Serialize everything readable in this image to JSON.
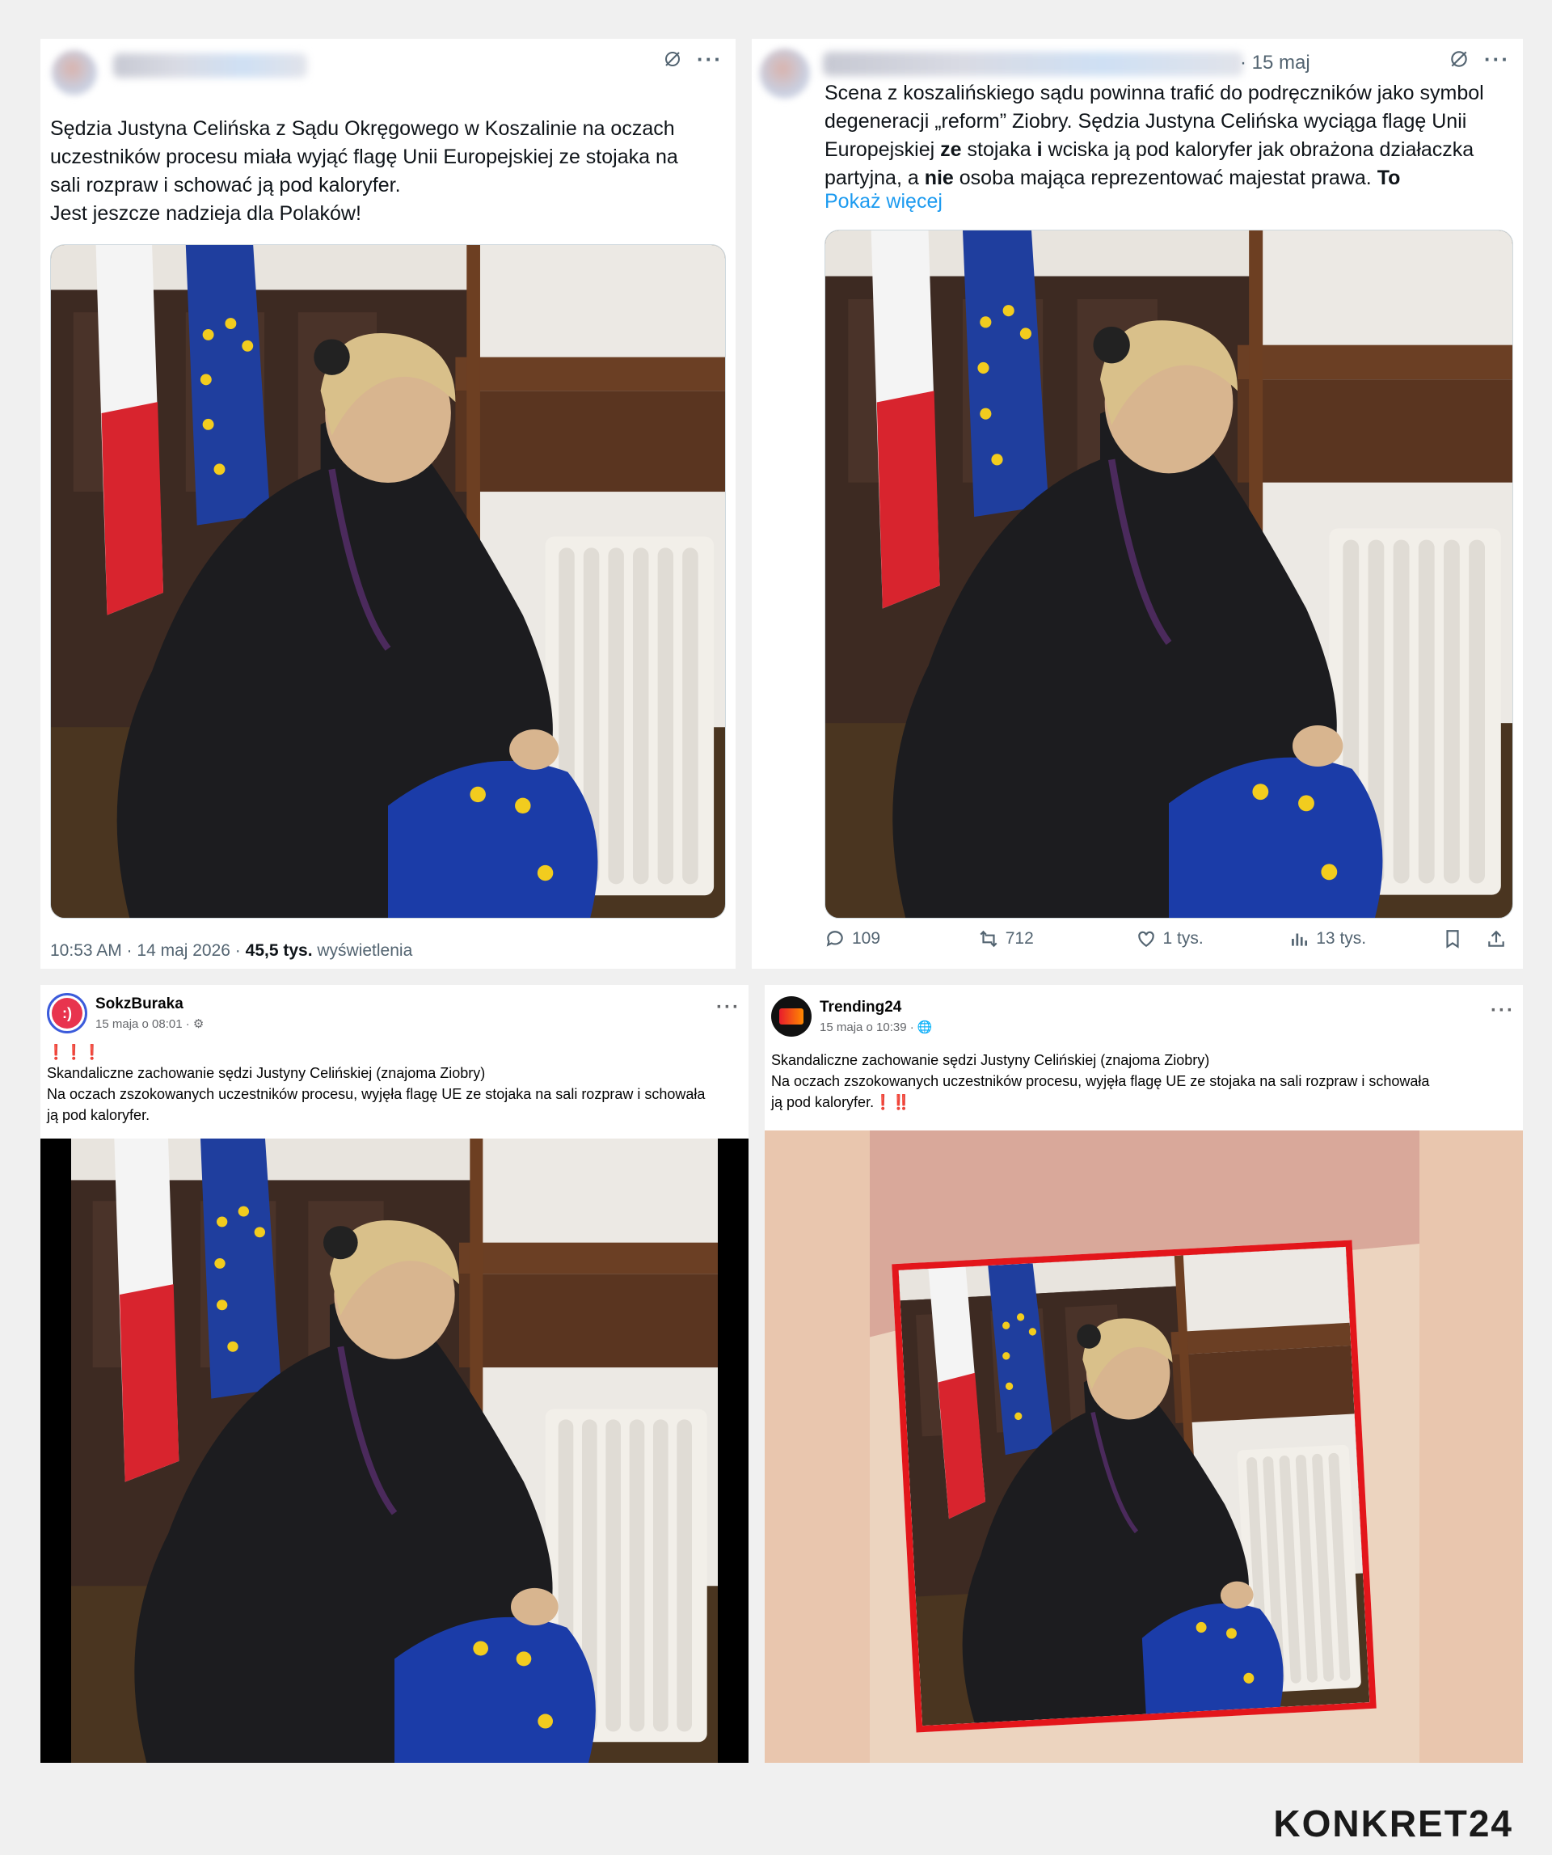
{
  "posts": {
    "p1": {
      "text": "Sędzia Justyna Celińska z Sądu Okręgowego w Koszalinie na oczach\nuczestników procesu miała  wyjąć flagę Unii Europejskiej ze stojaka na\nsali rozpraw i schować ją pod kaloryfer.\nJest jeszcze nadzieja dla Polaków!",
      "time": "10:53 AM · 14 maj 2026 · ",
      "views": "45,5 tys.",
      "views_label": " wyświetlenia"
    },
    "p2": {
      "date": "· 15 maj",
      "text_1": "Scena z koszalińskiego sądu powinna trafić do podręczników jako symbol\ndegeneracji „reform” Ziobry. Sędzia Justyna Celińska wyciąga flagę Unii\nEuropejskiej ",
      "bold_1": "ze",
      "text_2": " stojaka ",
      "bold_2": "i",
      "text_3": " wciska ją pod kaloryfer jak obrażona działaczka\npartyjna, a ",
      "bold_3": "nie",
      "text_4": " osoba mająca reprezentować majestat prawa. ",
      "bold_4": "To",
      "show_more": "Pokaż więcej",
      "replies": "109",
      "reposts": "712",
      "likes": "1 tys.",
      "views": "13 tys."
    },
    "p3": {
      "name": "SokzBuraka",
      "time": "15 maja o 08:01 · ",
      "avatar": ":)",
      "exclaim": "❗❗❗",
      "text": "Skandaliczne zachowanie sędzi Justyny Celińskiej (znajoma Ziobry)\nNa oczach zszokowanych uczestników procesu, wyjęła flagę UE ze stojaka na sali rozpraw i schowała\nją pod kaloryfer."
    },
    "p4": {
      "name": "Trending24",
      "time": "15 maja o 10:39 · ",
      "text": "Skandaliczne zachowanie sędzi Justyny Celińskiej (znajoma Ziobry)\nNa oczach zszokowanych uczestników procesu, wyjęła flagę UE ze stojaka na sali rozpraw i schowała\nją pod kaloryfer.",
      "exclaim": "❗‼️"
    }
  },
  "logo": "KONKRET24",
  "colors": {
    "link": "#1d9bf0",
    "muted": "#536471",
    "red_frame": "#e3161b",
    "fb_avatar_red": "#e8344e"
  },
  "icons": [
    "grok-icon",
    "more-icon",
    "reply-icon",
    "repost-icon",
    "like-icon",
    "views-icon",
    "bookmark-icon",
    "share-icon",
    "globe-icon",
    "settings-icon"
  ]
}
